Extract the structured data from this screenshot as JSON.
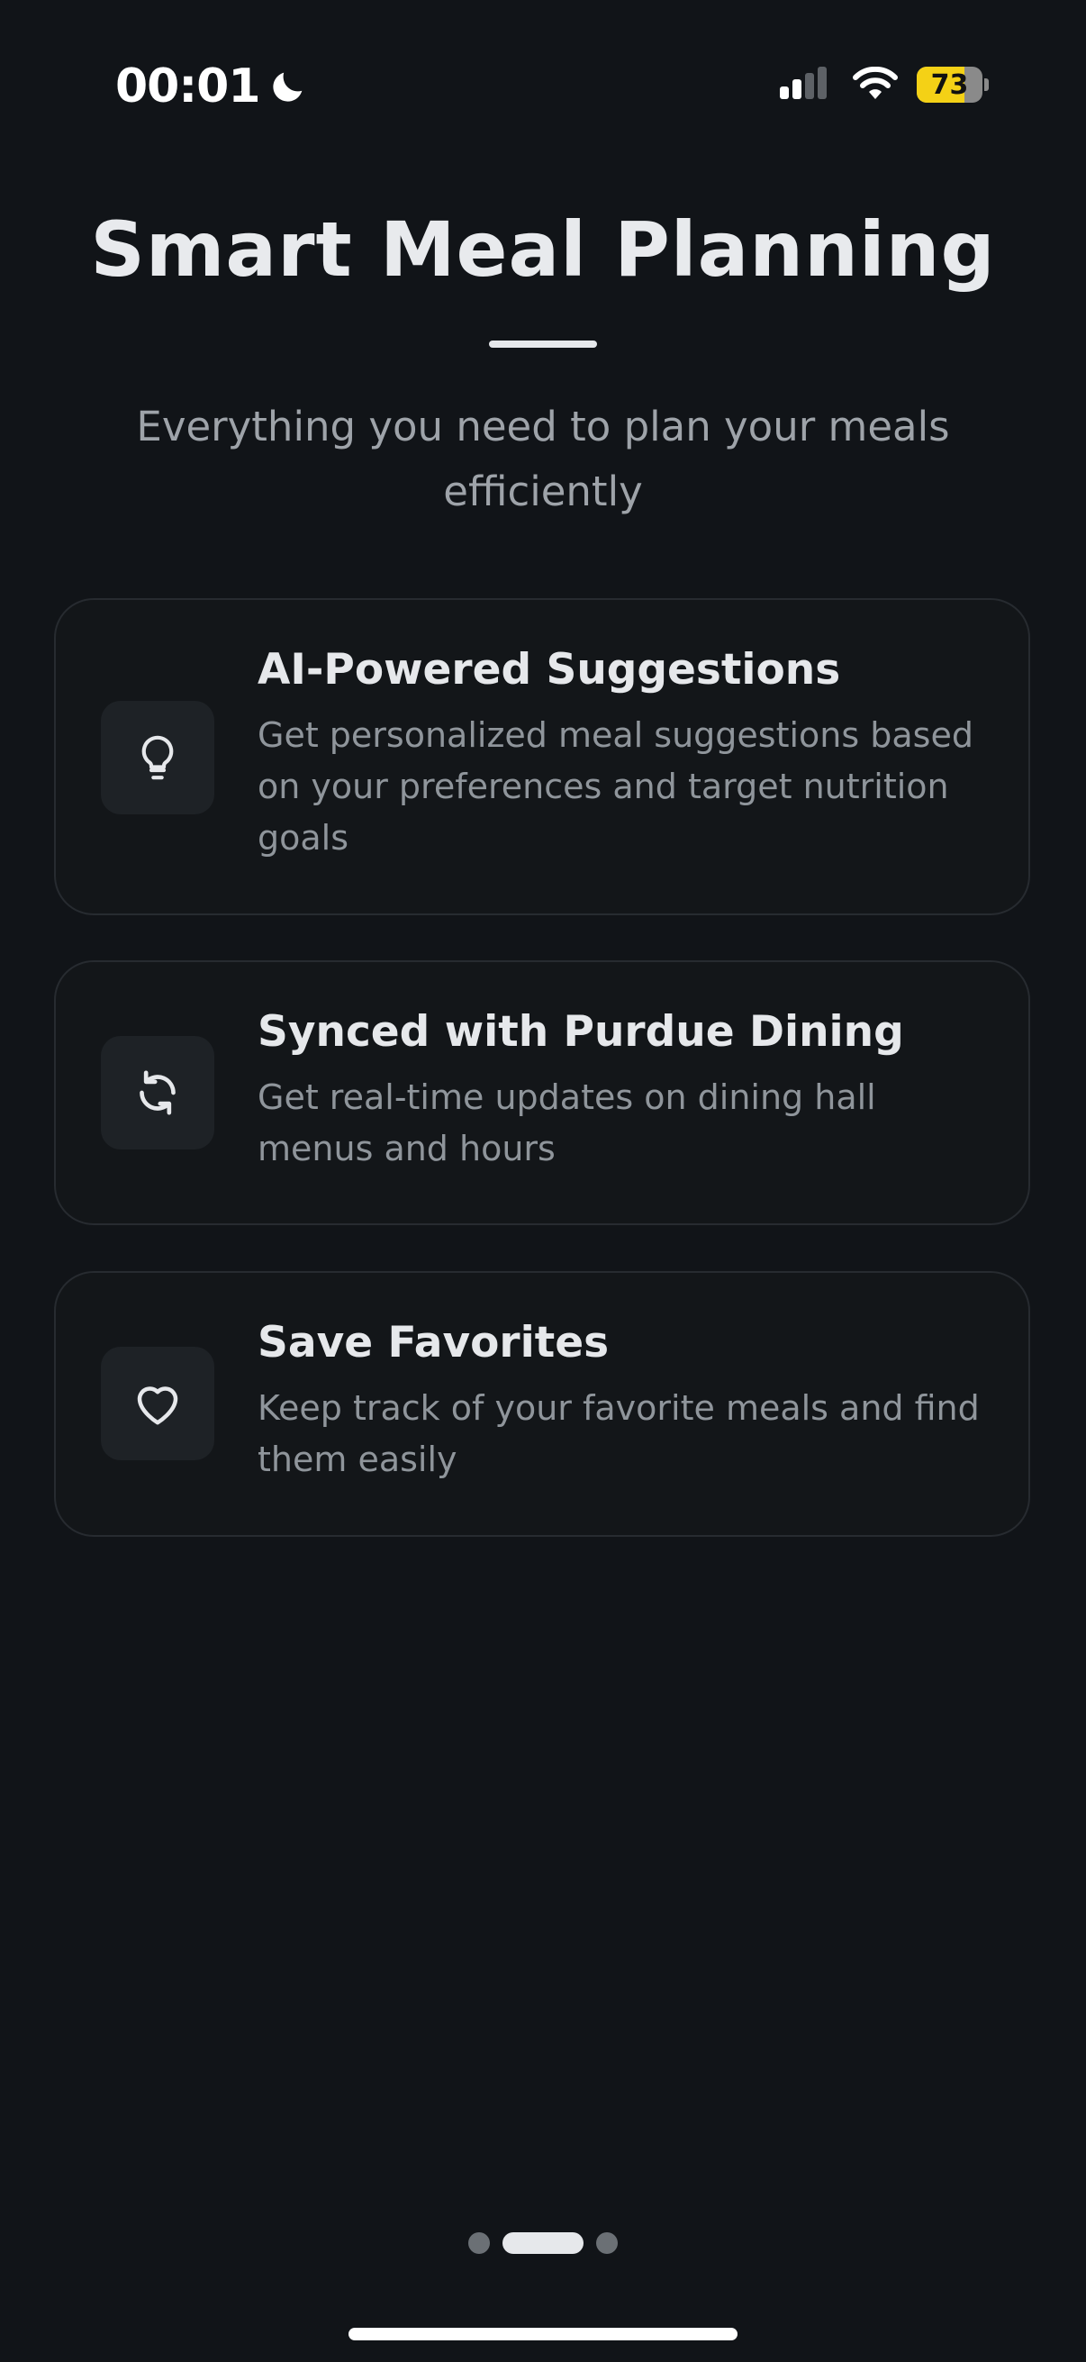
{
  "status_bar": {
    "time": "00:01",
    "battery_level": "73",
    "battery_fraction": 0.73
  },
  "header": {
    "title": "Smart Meal Planning",
    "subtitle": "Everything you need to plan your meals efficiently"
  },
  "features": [
    {
      "icon": "lightbulb-icon",
      "title": "AI-Powered Suggestions",
      "description": "Get personalized meal suggestions based on your preferences and target nutrition goals"
    },
    {
      "icon": "sync-icon",
      "title": "Synced with Purdue Dining",
      "description": "Get real-time updates on dining hall menus and hours"
    },
    {
      "icon": "heart-icon",
      "title": "Save Favorites",
      "description": "Keep track of your favorite meals and find them easily"
    }
  ],
  "pager": {
    "total_pages": 3,
    "current_page": 2
  },
  "colors": {
    "background": "#111418",
    "card_border": "#272b30",
    "icon_box": "#1e2226",
    "text_primary": "#e6e8eb",
    "text_secondary": "#8f959b",
    "battery": "#f4d116"
  }
}
